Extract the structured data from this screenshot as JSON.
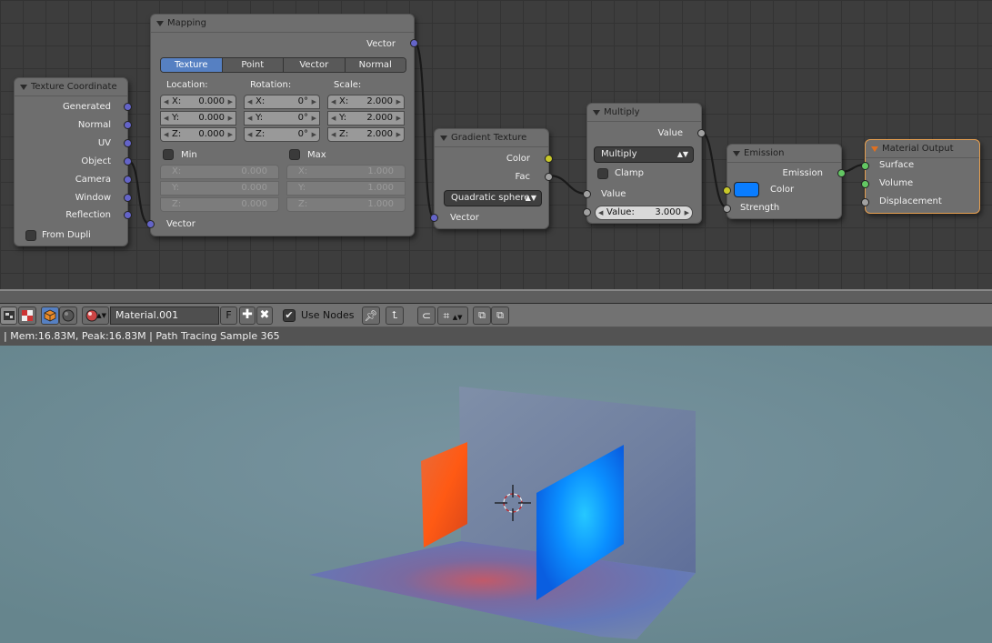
{
  "nodes": {
    "texture_coordinate": {
      "title": "Texture Coordinate",
      "outputs": [
        "Generated",
        "Normal",
        "UV",
        "Object",
        "Camera",
        "Window",
        "Reflection"
      ],
      "from_dupli_label": "From Dupli"
    },
    "mapping": {
      "title": "Mapping",
      "output_vector": "Vector",
      "tabs": [
        "Texture",
        "Point",
        "Vector",
        "Normal"
      ],
      "selected_tab": "Texture",
      "location_label": "Location:",
      "rotation_label": "Rotation:",
      "scale_label": "Scale:",
      "location": [
        {
          "axis": "X:",
          "value": "0.000"
        },
        {
          "axis": "Y:",
          "value": "0.000"
        },
        {
          "axis": "Z:",
          "value": "0.000"
        }
      ],
      "rotation": [
        {
          "axis": "X:",
          "value": "0°"
        },
        {
          "axis": "Y:",
          "value": "0°"
        },
        {
          "axis": "Z:",
          "value": "0°"
        }
      ],
      "scale": [
        {
          "axis": "X:",
          "value": "2.000"
        },
        {
          "axis": "Y:",
          "value": "2.000"
        },
        {
          "axis": "Z:",
          "value": "2.000"
        }
      ],
      "min_label": "Min",
      "max_label": "Max",
      "min": [
        {
          "axis": "X:",
          "value": "0.000"
        },
        {
          "axis": "Y:",
          "value": "0.000"
        },
        {
          "axis": "Z:",
          "value": "0.000"
        }
      ],
      "max": [
        {
          "axis": "X:",
          "value": "1.000"
        },
        {
          "axis": "Y:",
          "value": "1.000"
        },
        {
          "axis": "Z:",
          "value": "1.000"
        }
      ],
      "input_vector": "Vector"
    },
    "gradient_texture": {
      "title": "Gradient Texture",
      "output_color": "Color",
      "output_fac": "Fac",
      "gradient_type": "Quadratic sphere",
      "input_vector": "Vector"
    },
    "multiply": {
      "title": "Multiply",
      "output_value": "Value",
      "operation": "Multiply",
      "clamp_label": "Clamp",
      "input_value": "Value",
      "value_field_label": "Value:",
      "value_field_value": "3.000"
    },
    "emission": {
      "title": "Emission",
      "output_emission": "Emission",
      "input_color": "Color",
      "input_strength": "Strength",
      "color_hex": "#0a7dff"
    },
    "material_output": {
      "title": "Material Output",
      "inputs": [
        "Surface",
        "Volume",
        "Displacement"
      ]
    }
  },
  "toolbar": {
    "material_name": "Material.001",
    "fake_user_label": "F",
    "use_nodes_label": "Use Nodes",
    "use_nodes_checked": "✔"
  },
  "status": {
    "text": "| Mem:16.83M, Peak:16.83M | Path Tracing Sample 365"
  },
  "colors": {
    "accent_blue": "#5680c2",
    "emission_blue": "#0a7dff",
    "orange_panel": "#ff6020",
    "active_border": "#e8a050"
  }
}
